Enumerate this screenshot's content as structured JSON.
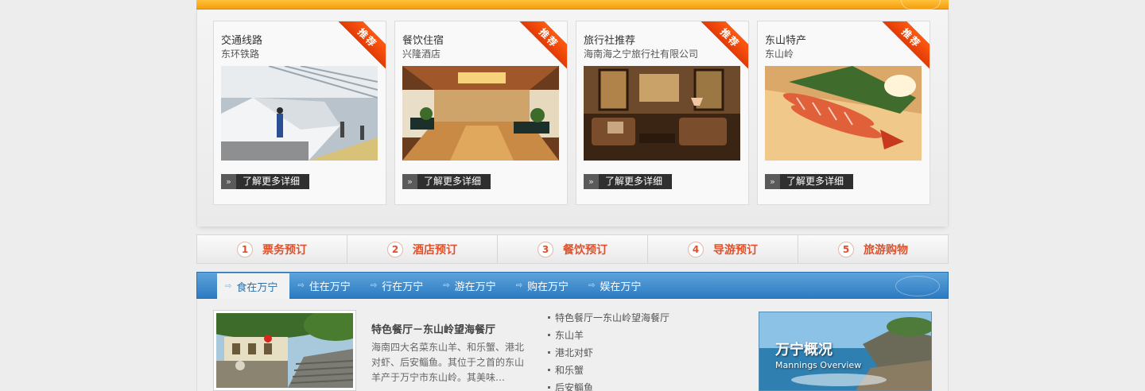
{
  "recommend_cards": [
    {
      "badge": "推荐",
      "title": "交通线路",
      "subtitle": "东环铁路",
      "photo_icon": "train-photo",
      "more_label": "了解更多详细"
    },
    {
      "badge": "推荐",
      "title": "餐饮住宿",
      "subtitle": "兴隆酒店",
      "photo_icon": "hotel-lobby-photo",
      "more_label": "了解更多详细"
    },
    {
      "badge": "推荐",
      "title": "旅行社推荐",
      "subtitle": "海南海之宁旅行社有限公司",
      "photo_icon": "lounge-photo",
      "more_label": "了解更多详细"
    },
    {
      "badge": "推荐",
      "title": "东山特产",
      "subtitle": "东山岭",
      "photo_icon": "shrimp-dish-photo",
      "more_label": "了解更多详细"
    }
  ],
  "booking_steps": [
    {
      "num": "1",
      "label": "票务预订"
    },
    {
      "num": "2",
      "label": "酒店预订"
    },
    {
      "num": "3",
      "label": "餐饮预订"
    },
    {
      "num": "4",
      "label": "导游预订"
    },
    {
      "num": "5",
      "label": "旅游购物"
    }
  ],
  "tabs": [
    {
      "label": "食在万宁",
      "active": true
    },
    {
      "label": "住在万宁",
      "active": false
    },
    {
      "label": "行在万宁",
      "active": false
    },
    {
      "label": "游在万宁",
      "active": false
    },
    {
      "label": "购在万宁",
      "active": false
    },
    {
      "label": "娱在万宁",
      "active": false
    }
  ],
  "featured": {
    "title": "特色餐厅－东山岭望海餐厅",
    "description": "海南四大名菜东山羊、和乐蟹、港北对虾、后安鲻鱼。其位于之首的东山羊产于万宁市东山岭。其美味…",
    "photo_icon": "restaurant-garden-photo"
  },
  "links": [
    "特色餐厅一东山岭望海餐厅",
    "东山羊",
    "港北对虾",
    "和乐蟹",
    "后安鲻鱼"
  ],
  "overview": {
    "title": "万宁概况",
    "subtitle": "Mannings Overview"
  },
  "colors": {
    "accent_orange": "#f59d0f",
    "ribbon_red": "#e23a06",
    "step_text": "#e0502a",
    "tab_blue": "#2c7bc2"
  }
}
